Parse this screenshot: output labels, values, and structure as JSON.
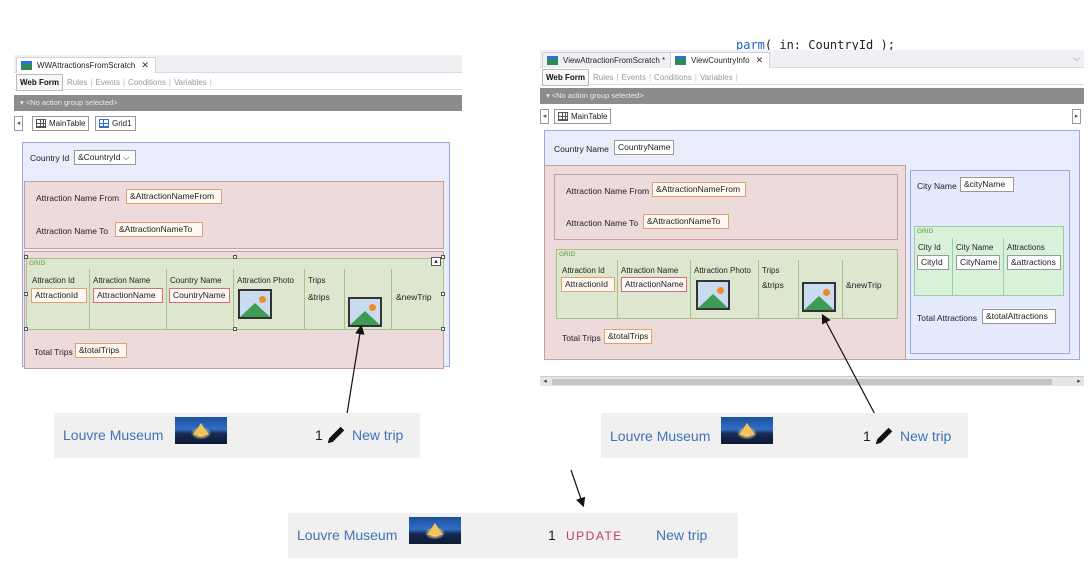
{
  "code": {
    "keyword": "parm",
    "rest": "( in: CountryId );",
    "colors": {
      "keyword": "#1c63c7"
    }
  },
  "left_panel": {
    "tab_title": "WWAttractionsFromScratch",
    "subtabs": [
      "Web Form",
      "Rules",
      "Events",
      "Conditions",
      "Variables"
    ],
    "action_group": "<No action group selected>",
    "breadcrumbs": [
      "MainTable",
      "Grid1"
    ],
    "country_label": "Country Id",
    "country_value": "&CountryId",
    "from_label": "Attraction Name From",
    "from_value": "&AttractionNameFrom",
    "to_label": "Attraction Name To",
    "to_value": "&AttractionNameTo",
    "grid_tag": "GRID",
    "columns": [
      "Attraction Id",
      "Attraction Name",
      "Country Name",
      "Attraction Photo",
      "Trips"
    ],
    "cells": [
      "AttractionId",
      "AttractionName",
      "CountryName",
      "&trips",
      "&newTrip"
    ],
    "total_label": "Total Trips",
    "total_value": "&totalTrips"
  },
  "right_panel": {
    "tabs": [
      "ViewAttractionFromScratch *",
      "ViewCountryInfo"
    ],
    "subtabs": [
      "Web Form",
      "Rules",
      "Events",
      "Conditions",
      "Variables"
    ],
    "action_group": "<No action group selected>",
    "breadcrumbs": [
      "MainTable"
    ],
    "country_label": "Country Name",
    "country_value": "CountryName",
    "from_label": "Attraction Name From",
    "from_value": "&AttractionNameFrom",
    "to_label": "Attraction Name To",
    "to_value": "&AttractionNameTo",
    "grid_tag": "GRID",
    "columns": [
      "Attraction Id",
      "Attraction Name",
      "Attraction Photo",
      "Trips"
    ],
    "cells": [
      "AttractionId",
      "AttractionName",
      "&trips",
      "&newTrip"
    ],
    "total_label": "Total Trips",
    "total_value": "&totalTrips",
    "city_label": "City Name",
    "city_value": "&cityName",
    "city_grid_tag": "GRID",
    "city_columns": [
      "City Id",
      "City Name",
      "Attractions"
    ],
    "city_cells": [
      "CityId",
      "CityName",
      "&attractions"
    ],
    "total_attr_label": "Total Attractions",
    "total_attr_value": "&totalAttractions"
  },
  "rows": [
    {
      "place": "Louvre Museum",
      "count": "1",
      "action": "New trip"
    },
    {
      "place": "Louvre Museum",
      "count": "1",
      "action": "New trip"
    },
    {
      "place": "Louvre Museum",
      "count": "1",
      "update": "UPDATE",
      "action": "New trip"
    }
  ],
  "icons": [
    "close-icon",
    "grid-icon",
    "pencil-icon",
    "image-placeholder-icon",
    "arrow-icon"
  ]
}
